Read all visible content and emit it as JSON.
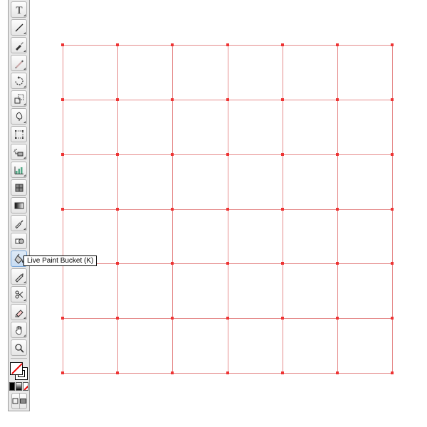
{
  "tooltip": {
    "text": "Live Paint Bucket (K)"
  },
  "tools": [
    {
      "name": "type-tool"
    },
    {
      "name": "line-tool"
    },
    {
      "name": "paintbrush-tool"
    },
    {
      "name": "pencil-tool"
    },
    {
      "name": "rotate-tool"
    },
    {
      "name": "scale-tool"
    },
    {
      "name": "warp-tool"
    },
    {
      "name": "free-transform-tool"
    },
    {
      "name": "symbol-sprayer-tool"
    },
    {
      "name": "graph-tool"
    },
    {
      "name": "mesh-tool"
    },
    {
      "name": "gradient-tool"
    },
    {
      "name": "eyedropper-tool"
    },
    {
      "name": "blend-tool"
    },
    {
      "name": "live-paint-bucket-tool"
    },
    {
      "name": "slice-tool"
    },
    {
      "name": "scissors-tool"
    },
    {
      "name": "eraser-tool"
    },
    {
      "name": "hand-tool"
    },
    {
      "name": "zoom-tool"
    }
  ],
  "grid": {
    "rows": 6,
    "cols": 6,
    "stroke": "#e58a8a"
  }
}
